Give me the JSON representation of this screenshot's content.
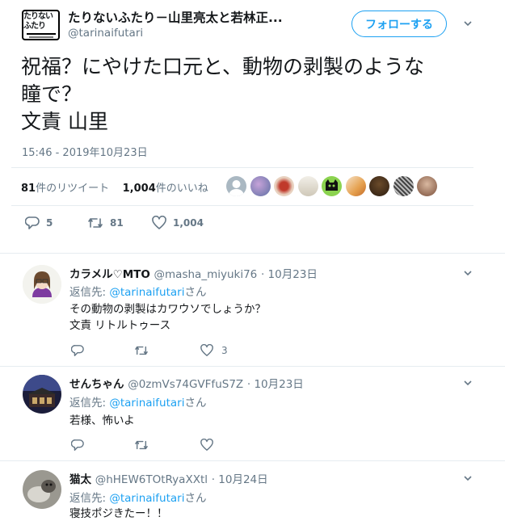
{
  "header": {
    "account_name": "たりないふたり－山里亮太と若林正...",
    "handle": "@tarinaifutari",
    "follow_label": "フォローする",
    "logo_text": "たりないふたり"
  },
  "tweet": {
    "lines": [
      "祝福？にやけた口元と、動物の剥製のような",
      "瞳で？",
      "文責 山里"
    ],
    "timestamp": "15:46 - 2019年10月23日",
    "retweets_count": "81",
    "retweets_label": "件のリツイート",
    "likes_count": "1,004",
    "likes_label": "件のいいね",
    "actions": {
      "replies": "5",
      "retweets": "81",
      "likes": "1,004"
    }
  },
  "replies": [
    {
      "name": "カラメル♡MTO",
      "handle": "@masha_miyuki76",
      "date": "· 10月23日",
      "reply_to_prefix": "返信先: ",
      "reply_to_handle": "@tarinaifutari",
      "reply_to_suffix": "さん",
      "lines": [
        "その動物の剥製はカワウソでしょうか？",
        "文責 リトルトゥース"
      ],
      "likes": "3"
    },
    {
      "name": "せんちゃん",
      "handle": "@0zmVs74GVFfuS7Z",
      "date": "· 10月23日",
      "reply_to_prefix": "返信先: ",
      "reply_to_handle": "@tarinaifutari",
      "reply_to_suffix": "さん",
      "lines": [
        "若様、怖いよ"
      ],
      "likes": ""
    },
    {
      "name": "猫太",
      "handle": "@hHEW6TOtRyaXXtl",
      "date": "· 10月24日",
      "reply_to_prefix": "返信先: ",
      "reply_to_handle": "@tarinaifutari",
      "reply_to_suffix": "さん",
      "lines": [
        "寝技ポジきたー！！"
      ],
      "likes": ""
    }
  ],
  "colors": {
    "accent": "#1da1f2",
    "muted": "#657786",
    "text": "#14171a",
    "border": "#e6ecf0"
  },
  "icons": [
    "chevron-down-icon",
    "reply-icon",
    "retweet-icon",
    "heart-icon"
  ]
}
